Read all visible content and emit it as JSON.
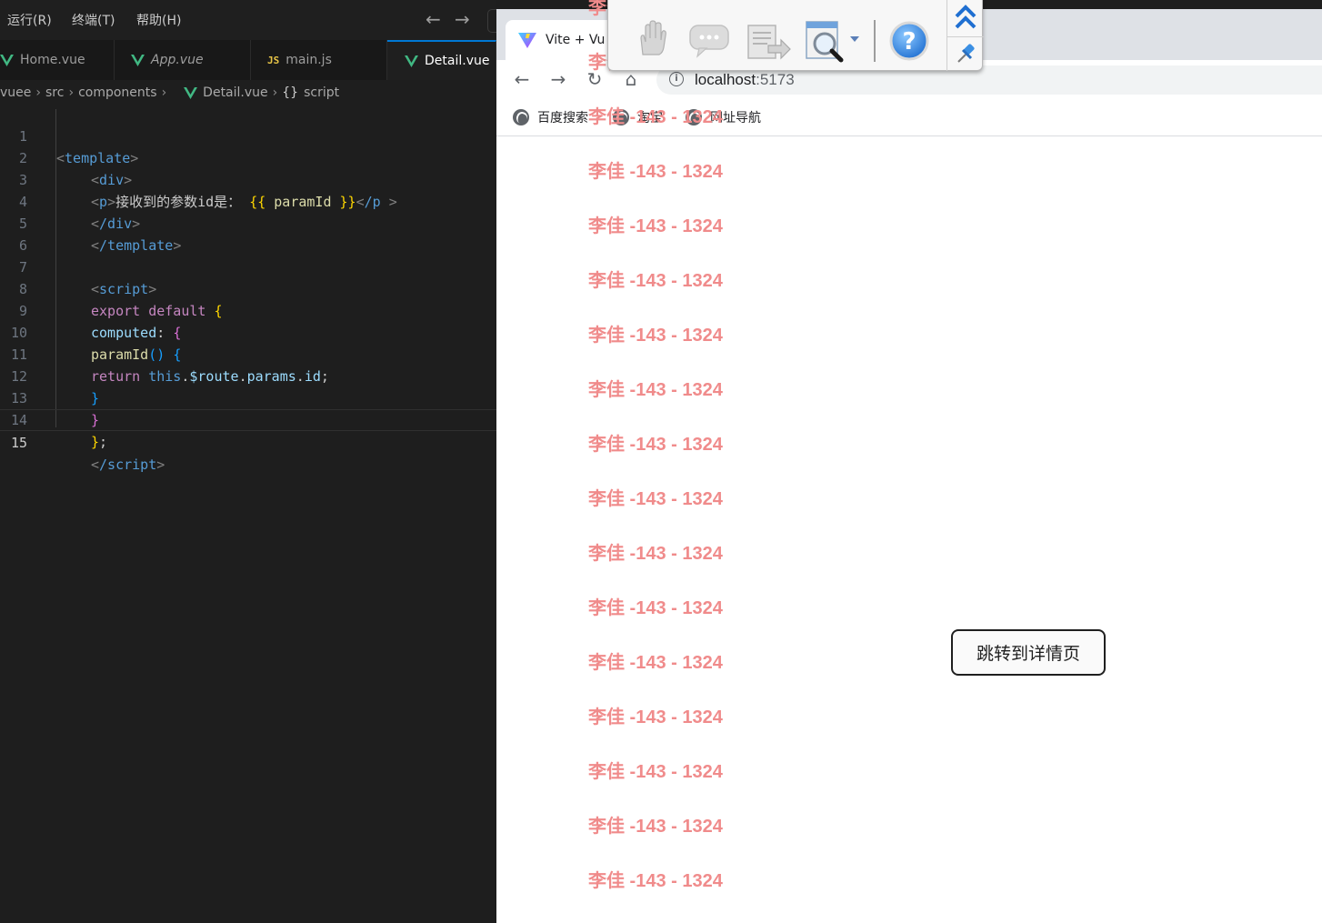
{
  "vscode": {
    "menu": [
      "运行(R)",
      "终端(T)",
      "帮助(H)"
    ],
    "tabs": [
      {
        "label": "Home.vue",
        "icon": "vue-icon"
      },
      {
        "label": "App.vue",
        "icon": "vue-icon"
      },
      {
        "label": "main.js",
        "icon": "js-icon",
        "icon_text": "JS"
      },
      {
        "label": "Detail.vue",
        "icon": "vue-icon"
      }
    ],
    "breadcrumb": [
      "vuee",
      "src",
      "components",
      "Detail.vue",
      "script"
    ],
    "breadcrumb_script_icon": "{}",
    "line_numbers": [
      "1",
      "2",
      "3",
      "4",
      "5",
      "6",
      "7",
      "8",
      "9",
      "10",
      "11",
      "12",
      "13",
      "14",
      "15"
    ],
    "current_line": "15",
    "code": {
      "l1_tag": "template",
      "l2_tag": "div",
      "l3_tag": "p",
      "l3_text": "接收到的参数id是：",
      "l3_open": "{{",
      "l3_var": "paramId",
      "l3_close": "}}",
      "l3_endtag": "/p",
      "l4_tag": "/div",
      "l5_tag": "/template",
      "l7_tag": "script",
      "l8_export": "export",
      "l8_default": "default",
      "l9_computed": "computed",
      "l10_fn": "paramId",
      "l11_return": "return",
      "l11_this": "this",
      "l11_route": "$route",
      "l11_params": "params",
      "l11_id": "id",
      "l15_tag": "/script"
    }
  },
  "browser": {
    "tab_title": "Vite + Vu",
    "url_host": "localhost",
    "url_port": ":5173",
    "bookmarks": [
      "百度搜索",
      "淘宝",
      "网址导航"
    ],
    "button_label": "跳转到详情页"
  },
  "watermark": {
    "text": "李佳 -143 - 1324",
    "count": 17
  },
  "colors": {
    "watermark": "#f08b8b",
    "vue_green": "#41b883",
    "active_tab_border": "#0078d4"
  },
  "floating_toolbar_icons": [
    "hand-icon",
    "comment-icon",
    "export-document-icon",
    "zoom-icon",
    "help-icon",
    "collapse-up-icon",
    "pin-icon"
  ]
}
